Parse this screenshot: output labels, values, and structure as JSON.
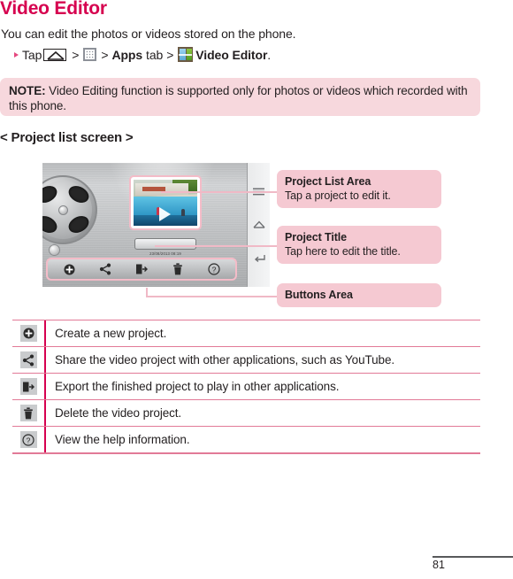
{
  "heading": "Video Editor",
  "intro": "You can edit the photos or videos stored on the phone.",
  "step": {
    "tap": "Tap",
    "sep": ">",
    "apps_label": "Apps",
    "tab_word": "tab",
    "app_name": "Video Editor",
    "period": "."
  },
  "note": {
    "label": "NOTE:",
    "text": "Video Editing function is supported only for photos or videos which recorded with this phone."
  },
  "section_label": "< Project list screen >",
  "screenshot": {
    "date_stamp": "23/08/2013 08:19",
    "nav_icons": [
      "menu-icon",
      "home-icon",
      "back-icon"
    ],
    "button_icons": [
      "add-icon",
      "share-icon",
      "export-icon",
      "delete-icon",
      "help-icon"
    ]
  },
  "callouts": [
    {
      "title": "Project List Area",
      "desc": "Tap a project to edit it."
    },
    {
      "title": "Project Title",
      "desc": "Tap here to edit the title."
    },
    {
      "title": "Buttons Area",
      "desc": ""
    }
  ],
  "table": {
    "rows": [
      {
        "icon": "add-icon",
        "text": "Create a new project."
      },
      {
        "icon": "share-icon",
        "text": "Share the video project with other applications, such as YouTube."
      },
      {
        "icon": "export-icon",
        "text": "Export the finished project to play in other applications."
      },
      {
        "icon": "delete-icon",
        "text": "Delete the video project."
      },
      {
        "icon": "help-icon",
        "text": "View the help information."
      }
    ]
  },
  "footer": {
    "page_number": "81"
  },
  "colors": {
    "heading": "#d6004f",
    "note_bg": "#f7d8dd",
    "callout_bg": "#f5c9d2",
    "rule": "#e27a97",
    "divider": "#d6004f",
    "bullet": "#e5487f"
  }
}
